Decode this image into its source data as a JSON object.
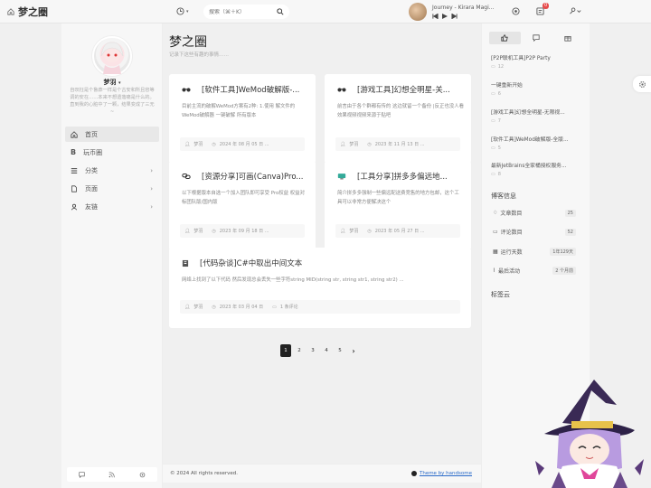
{
  "site": {
    "title": "梦之圈"
  },
  "search": {
    "placeholder": "搜索（⌘＋K）"
  },
  "player": {
    "song": "Journey - Kirara Magi..."
  },
  "notifications": {
    "badge": "0"
  },
  "sidebar": {
    "user_name": "梦羽",
    "bio": "自叹枉是个鲁莽一样是个古安和所且容等调的安在……本来不想遗落痛是什么的。直到我的心脏中了一颗，结果变成了三无~",
    "nav": [
      {
        "label": "首页",
        "icon": "home-icon"
      },
      {
        "label": "玩币圈",
        "icon": "bitcoin-icon"
      },
      {
        "label": "分类",
        "icon": "grid-icon"
      },
      {
        "label": "页面",
        "icon": "file-icon"
      },
      {
        "label": "友链",
        "icon": "user-icon"
      }
    ]
  },
  "main": {
    "title": "梦之圈",
    "subtitle": "记录下这些有趣的事情……",
    "posts": [
      {
        "title": "[软件工具]WeMod破解版-...",
        "excerpt": "目前主流的破解WeMod方案有2种: 1.使用 解文件的WeMod破解器 一键破解 所有版本",
        "author": "梦羽",
        "date": "2024 年 08 月 05 日 ..."
      },
      {
        "title": "[游戏工具]幻想全明星-关...",
        "excerpt": "前言由于各个群都有传的 这边就留一个备份 |反正也没人看效果视频视频来源于贴吧",
        "author": "梦羽",
        "date": "2023 年 11 月 13 日 ..."
      },
      {
        "title": "[资源分享]可画(Canva)Pro...",
        "excerpt": "以下根据版本自选一个加入团队即可享受 Pro权益 权益对标团队版/国内版",
        "author": "梦羽",
        "date": "2023 年 09 月 18 日 ..."
      },
      {
        "title": "[工具分享]拼多多偏远地...",
        "excerpt": "简介拼多多强制一些偏远配送费竞售的地方包邮，这个工具可以非常方便解决这个",
        "author": "梦羽",
        "date": "2023 年 05 月 27 日 ..."
      },
      {
        "title": "[代码杂谈]C#中取出中间文本",
        "excerpt": "网络上找到了以下代码 然后发现总会丢失一些字符string MID(string str, string str1, string str2) ...",
        "author": "梦羽",
        "date": "2023 年 03 月 04 日",
        "comments": "1 条评论"
      }
    ],
    "pages": [
      "1",
      "2",
      "3",
      "4",
      "5"
    ],
    "footer": {
      "copyright": "© 2024 All rights reserved.",
      "theme": "Theme by handsome"
    }
  },
  "right": {
    "recent": [
      {
        "title": "[P2P联机工具]P2P Party",
        "count": "12"
      },
      {
        "title": "一键重新开始",
        "count": "6"
      },
      {
        "title": "[游戏工具]幻想全明星-无限视...",
        "count": "7"
      },
      {
        "title": "[软件工具]WeMod破解版-全版...",
        "count": "5"
      },
      {
        "title": "最新JetBrains全家桶授权服务...",
        "count": "8"
      }
    ],
    "blog_info_title": "博客信息",
    "stats": [
      {
        "label": "文章数目",
        "value": "25"
      },
      {
        "label": "评论数目",
        "value": "52"
      },
      {
        "label": "运行天数",
        "value": "1年129天"
      },
      {
        "label": "最后活动",
        "value": "2 个月前"
      }
    ],
    "tags_title": "标签云"
  }
}
